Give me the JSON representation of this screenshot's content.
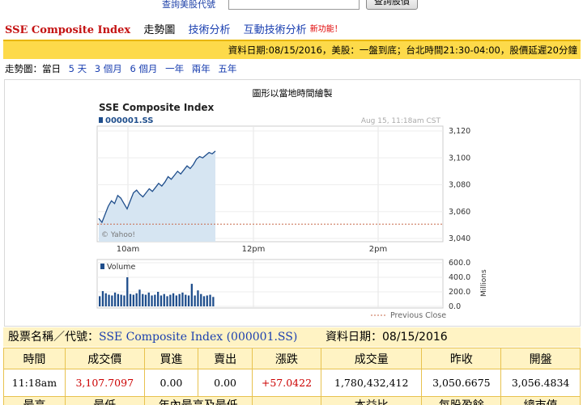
{
  "top": {
    "us_lookup_link": "查詢美股代號",
    "lookup_button": "查詢股價",
    "lookup_value": ""
  },
  "nav": {
    "title": "SSE Composite Index",
    "trend": "走勢圖",
    "tech": "技術分析",
    "interactive": "互動技術分析",
    "new_badge": "新功能！"
  },
  "infobar": "資料日期:08/15/2016，美股：一盤到底；台北時間21:30-04:00，股價延遲20分鐘",
  "ranges": {
    "label": "走勢圖：當日",
    "items": [
      "5 天",
      "3 個月",
      "6 個月",
      "一年",
      "兩年",
      "五年"
    ]
  },
  "chart_note": "圖形以當地時間繪製",
  "chart_data": {
    "type": "line",
    "title": "SSE Composite Index",
    "ticker": "000001.SS",
    "timestamp": "Aug 15, 11:18am CST",
    "source": "© Yahoo!",
    "x_labels": [
      "10am",
      "12pm",
      "2pm"
    ],
    "y_ticks": [
      3040,
      3060,
      3080,
      3100,
      3120
    ],
    "ylim": [
      3040,
      3120
    ],
    "previous_close": 3050.6675,
    "legend_prev_close": "Previous Close",
    "volume_label": "Volume",
    "volume_ticks": [
      "600.0",
      "400.0",
      "200.0",
      "0.0"
    ],
    "volume_unit": "Millions",
    "price_series": [
      3055,
      3052,
      3058,
      3064,
      3068,
      3066,
      3072,
      3070,
      3066,
      3062,
      3068,
      3074,
      3076,
      3073,
      3071,
      3074,
      3077,
      3075,
      3078,
      3081,
      3079,
      3082,
      3086,
      3084,
      3087,
      3090,
      3088,
      3091,
      3094,
      3092,
      3095,
      3099,
      3101,
      3100,
      3102,
      3104,
      3103,
      3105
    ],
    "volume_series": [
      140,
      210,
      180,
      160,
      150,
      190,
      170,
      160,
      150,
      400,
      170,
      160,
      180,
      230,
      170,
      160,
      190,
      150,
      160,
      200,
      150,
      170,
      140,
      160,
      180,
      150,
      170,
      190,
      160,
      150,
      310,
      150,
      220,
      170,
      140,
      150,
      160,
      130
    ]
  },
  "table": {
    "name_label": "股票名稱／代號：",
    "name_value": "SSE Composite Index (000001.SS)",
    "date_label": "資料日期：08/15/2016",
    "headers": [
      "時間",
      "成交價",
      "買進",
      "賣出",
      "漲跌",
      "成交量",
      "昨收",
      "開盤"
    ],
    "values": [
      "11:18am",
      "3,107.7097",
      "0.00",
      "0.00",
      "+57.0422",
      "1,780,432,412",
      "3,050.6675",
      "3,056.4834"
    ],
    "headers2": [
      "最高",
      "最低",
      "年內最高及最低",
      "",
      "本益比",
      "每股盈餘",
      "總市值",
      ""
    ]
  },
  "colors": {
    "accent": "#fdda4a",
    "price_fill": "#d6e5f2",
    "price_line": "#1f4e8c",
    "red": "#cc0000",
    "link": "#1a3fb0"
  }
}
